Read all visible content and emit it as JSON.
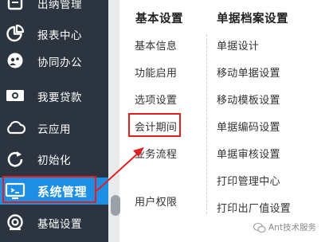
{
  "sidebar": {
    "items": [
      {
        "label": "出纳管理",
        "icon": "cashier-icon"
      },
      {
        "label": "报表中心",
        "icon": "pie-chart-icon"
      },
      {
        "label": "协同办公",
        "icon": "collaboration-icon"
      },
      {
        "label": "我要贷款",
        "icon": "cash-icon"
      },
      {
        "label": "云应用",
        "icon": "cloud-icon"
      },
      {
        "label": "初始化",
        "icon": "refresh-icon"
      },
      {
        "label": "系统管理",
        "icon": "monitor-icon",
        "active": true
      },
      {
        "label": "基础设置",
        "icon": "settings-icon"
      }
    ],
    "active_color": "#1f8fe6",
    "background_color": "#2c3440"
  },
  "panel": {
    "columns": [
      {
        "title": "基本设置",
        "links": [
          "基本信息",
          "功能启用",
          "选项设置",
          "会计期间",
          "业务流程",
          "用户权限"
        ]
      },
      {
        "title": "单据档案设置",
        "links": [
          "单据设计",
          "移动单据设置",
          "移动模板设置",
          "单据编码设置",
          "单据审核设置",
          "打印管理中心",
          "打印出厂值设置"
        ]
      }
    ]
  },
  "annotation": {
    "highlight_color": "#e02020"
  },
  "watermark": {
    "text": "Ant技术服务",
    "icon": "wechat-icon"
  }
}
